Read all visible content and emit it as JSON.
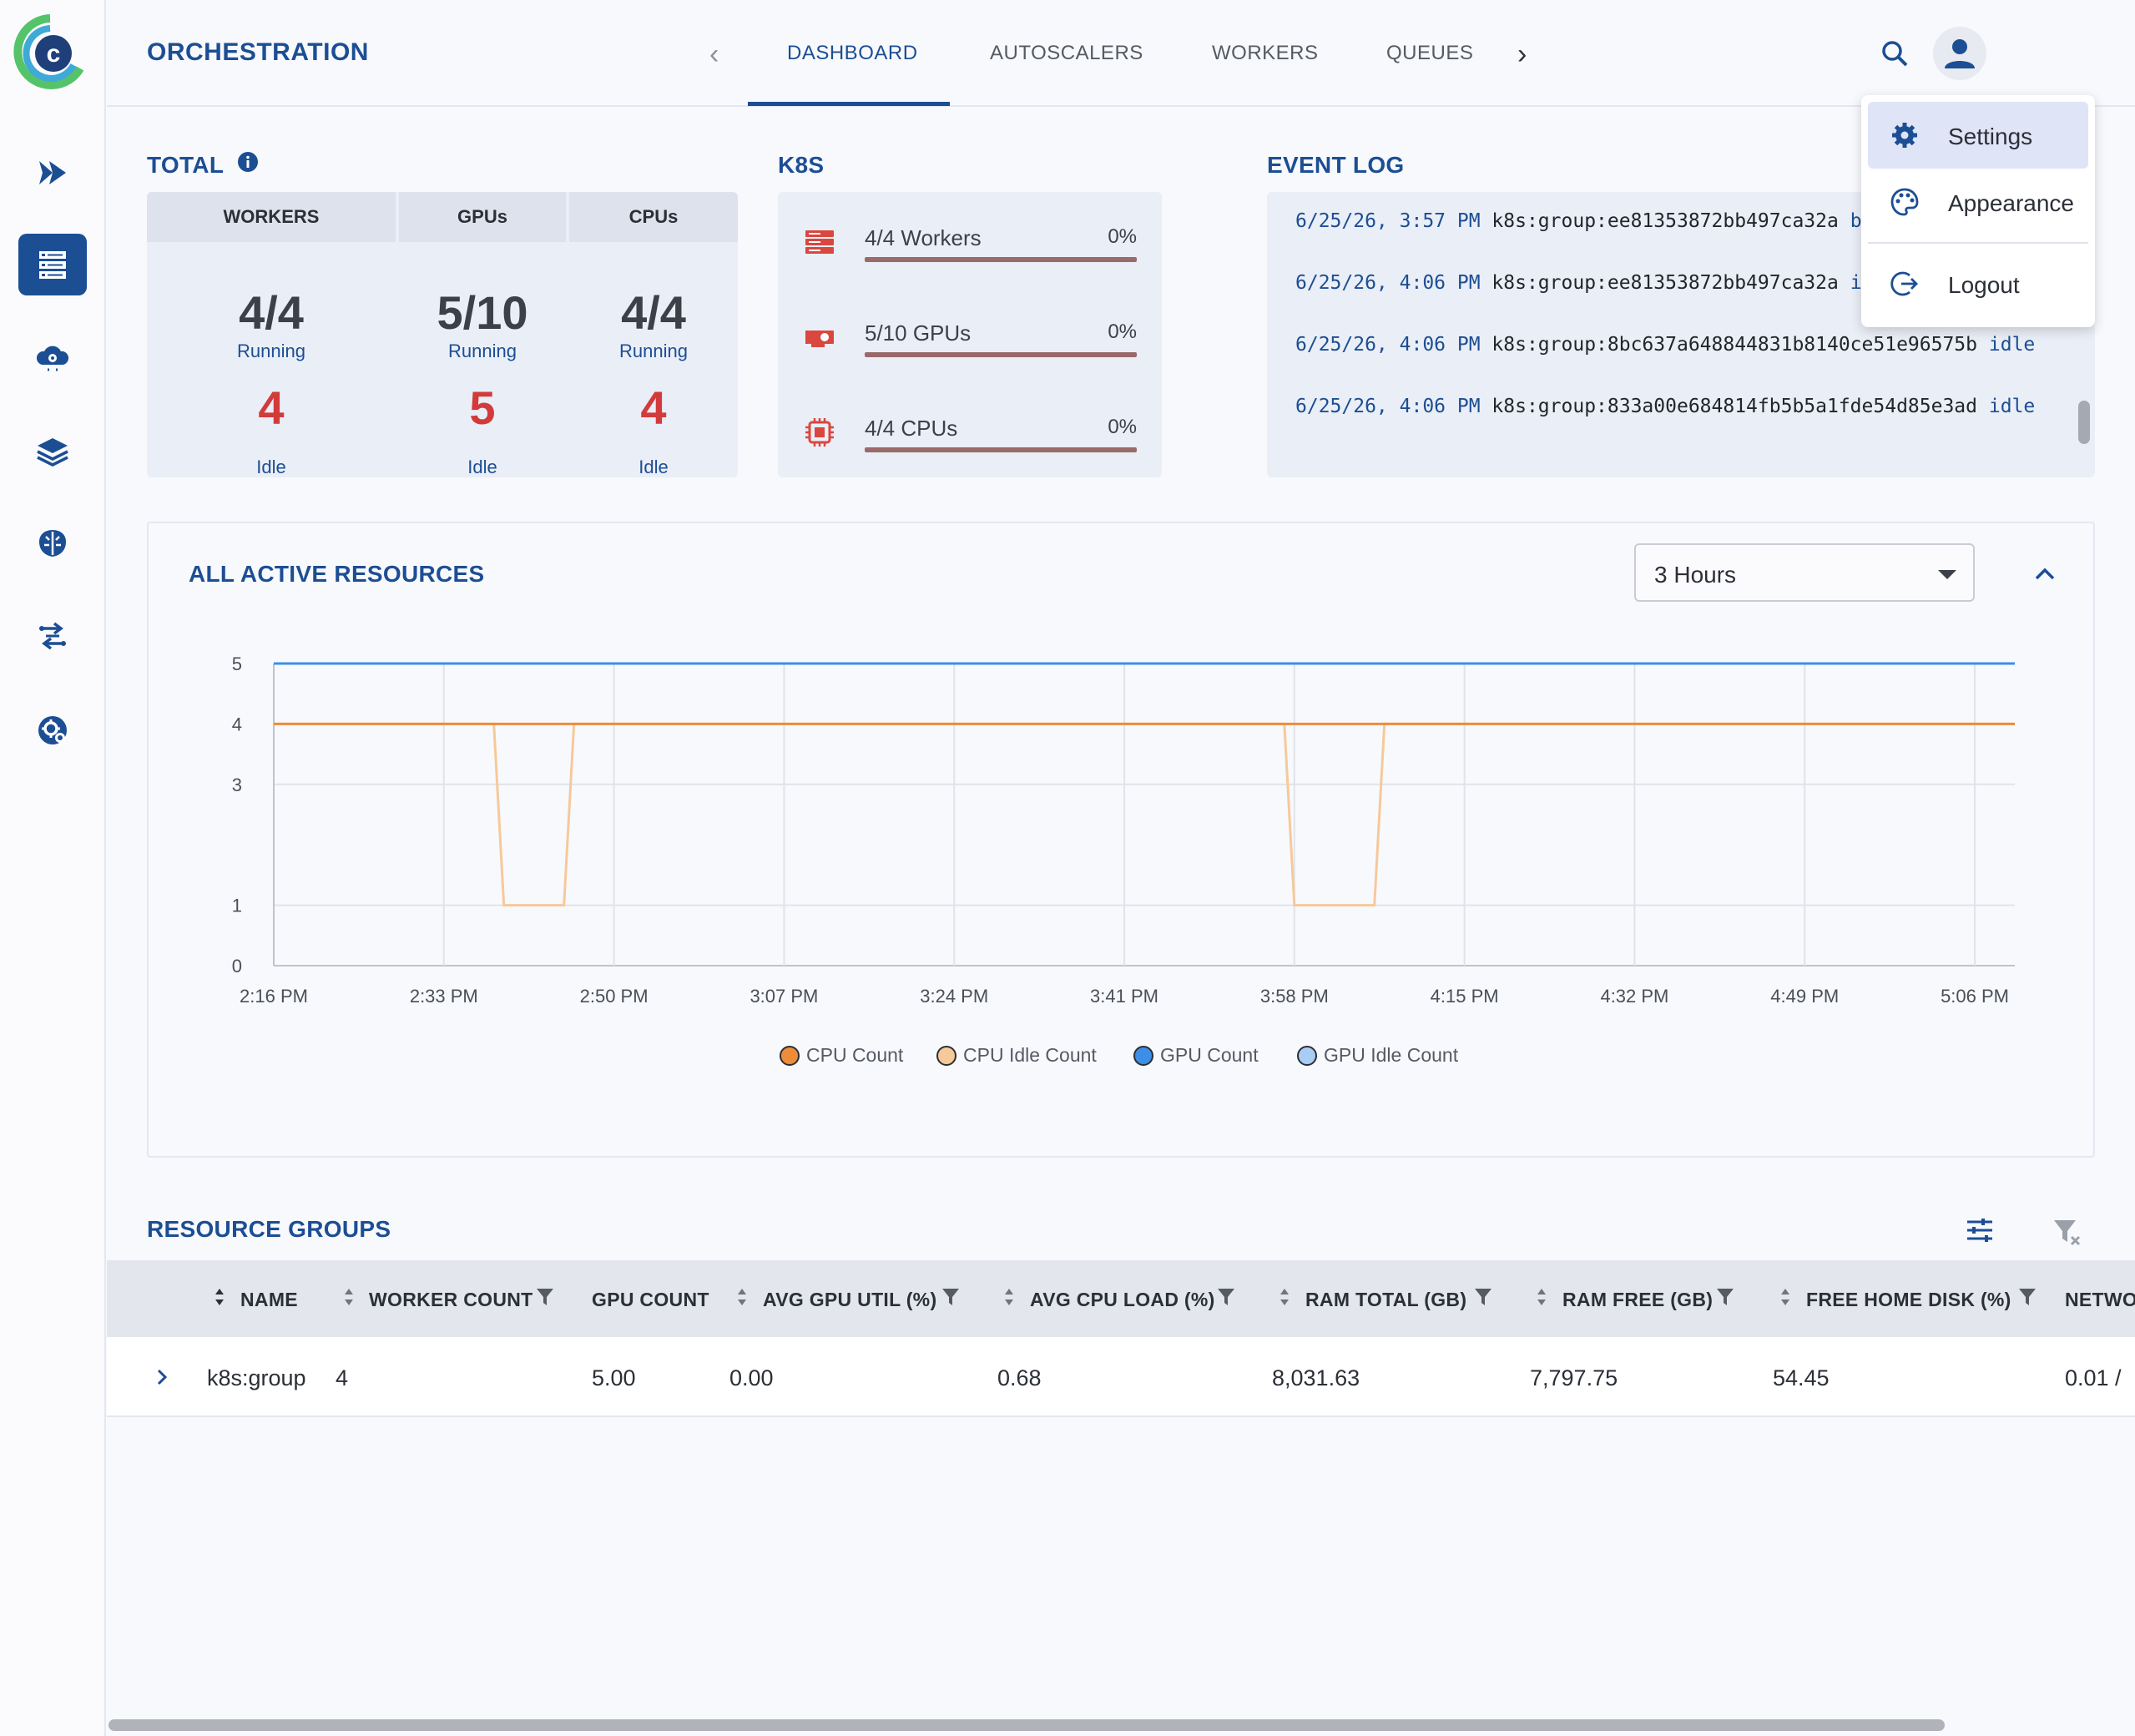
{
  "app": {
    "title": "ORCHESTRATION"
  },
  "tabs": [
    {
      "label": "DASHBOARD"
    },
    {
      "label": "AUTOSCALERS"
    },
    {
      "label": "WORKERS"
    },
    {
      "label": "QUEUES"
    }
  ],
  "user_menu": {
    "items": [
      {
        "label": "Settings",
        "icon": "gear-icon"
      },
      {
        "label": "Appearance",
        "icon": "palette-icon"
      },
      {
        "label": "Logout",
        "icon": "logout-icon"
      }
    ]
  },
  "total": {
    "title": "TOTAL",
    "columns": [
      {
        "header": "WORKERS",
        "running": "4/4",
        "running_label": "Running",
        "idle": "4",
        "idle_label": "Idle"
      },
      {
        "header": "GPUs",
        "running": "5/10",
        "running_label": "Running",
        "idle": "5",
        "idle_label": "Idle"
      },
      {
        "header": "CPUs",
        "running": "4/4",
        "running_label": "Running",
        "idle": "4",
        "idle_label": "Idle"
      }
    ]
  },
  "k8s": {
    "title": "K8S",
    "rows": [
      {
        "label": "4/4 Workers",
        "percent": "0%",
        "icon": "server-icon"
      },
      {
        "label": "5/10 GPUs",
        "percent": "0%",
        "icon": "gpu-icon"
      },
      {
        "label": "4/4 CPUs",
        "percent": "0%",
        "icon": "cpu-icon"
      }
    ]
  },
  "event_log": {
    "title": "EVENT LOG",
    "entries": [
      {
        "time": "6/25/26, 3:57 PM",
        "text": "k8s:group:ee81353872bb497ca32a",
        "status": "busy"
      },
      {
        "time": "6/25/26, 4:06 PM",
        "text": "k8s:group:ee81353872bb497ca32a",
        "status": "idle"
      },
      {
        "time": "6/25/26, 4:06 PM",
        "text": "k8s:group:8bc637a648844831b8140ce51e96575b",
        "status": "idle"
      },
      {
        "time": "6/25/26, 4:06 PM",
        "text": "k8s:group:833a00e684814fb5b5a1fde54d85e3ad",
        "status": "idle"
      }
    ]
  },
  "active_resources": {
    "title": "ALL ACTIVE RESOURCES",
    "range": "3 Hours"
  },
  "chart_data": {
    "type": "line",
    "title": "",
    "xlabel": "",
    "ylabel": "",
    "ylim": [
      0,
      5
    ],
    "y_ticks": [
      0,
      1,
      3,
      4,
      5
    ],
    "x_ticks": [
      "2:16 PM",
      "2:33 PM",
      "2:50 PM",
      "3:07 PM",
      "3:24 PM",
      "3:41 PM",
      "3:58 PM",
      "4:15 PM",
      "4:32 PM",
      "4:49 PM",
      "5:06 PM"
    ],
    "x_start": "2:16 PM",
    "x_end": "5:10 PM",
    "grid": true,
    "legend_position": "bottom",
    "series": [
      {
        "name": "CPU Count",
        "color": "#ee8c3a",
        "points": [
          [
            "2:16 PM",
            4
          ],
          [
            "5:10 PM",
            4
          ]
        ]
      },
      {
        "name": "CPU Idle Count",
        "color": "#f6c99a",
        "points": [
          [
            "2:16 PM",
            4
          ],
          [
            "2:38 PM",
            4
          ],
          [
            "2:39 PM",
            1
          ],
          [
            "2:45 PM",
            1
          ],
          [
            "2:46 PM",
            4
          ],
          [
            "3:57 PM",
            4
          ],
          [
            "3:58 PM",
            1
          ],
          [
            "4:06 PM",
            1
          ],
          [
            "4:07 PM",
            4
          ],
          [
            "5:10 PM",
            4
          ]
        ]
      },
      {
        "name": "GPU Count",
        "color": "#3d8ee6",
        "points": [
          [
            "2:16 PM",
            5
          ],
          [
            "5:10 PM",
            5
          ]
        ]
      },
      {
        "name": "GPU Idle Count",
        "color": "#a9cdf3",
        "points": [
          [
            "2:16 PM",
            5
          ],
          [
            "5:10 PM",
            5
          ]
        ]
      }
    ]
  },
  "resource_groups": {
    "title": "RESOURCE GROUPS",
    "columns": [
      "NAME",
      "WORKER COUNT",
      "GPU COUNT",
      "AVG GPU UTIL (%)",
      "AVG CPU LOAD (%)",
      "RAM TOTAL (GB)",
      "RAM FREE (GB)",
      "FREE HOME DISK (%)",
      "NETWO"
    ],
    "rows": [
      {
        "name": "k8s:group",
        "worker_count": "4",
        "gpu_count": "5.00",
        "avg_gpu_util": "0.00",
        "avg_cpu_load": "0.68",
        "ram_total": "8,031.63",
        "ram_free": "7,797.75",
        "free_home_disk": "54.45",
        "network": "0.01 /"
      }
    ]
  },
  "colors": {
    "brand": "#1c4e94",
    "idle_red": "#d23b3b",
    "k8s_icon_red": "#d9473f"
  }
}
